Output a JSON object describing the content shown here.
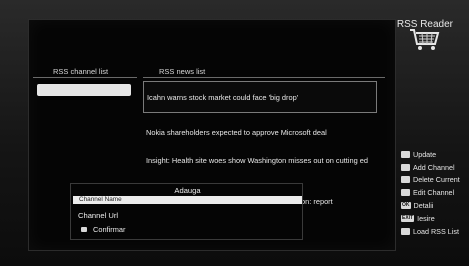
{
  "app": {
    "title": "RSS Reader"
  },
  "columns": {
    "channels_header": "RSS channel list",
    "news_header": "RSS news list"
  },
  "news": [
    "Icahn warns stock market could face 'big drop'",
    "Nokia shareholders expected to approve Microsoft deal",
    "Insight: Health site woes show Washington misses out on cutting ed",
    "t $8 billion: report"
  ],
  "side_menu": [
    {
      "key": "",
      "label": "Update"
    },
    {
      "key": "",
      "label": "Add Channel"
    },
    {
      "key": "",
      "label": "Delete Current"
    },
    {
      "key": "",
      "label": "Edit Channel"
    },
    {
      "key": "OK",
      "label": "Detalii"
    },
    {
      "key": "EXIT",
      "label": "Iesire"
    },
    {
      "key": "",
      "label": "Load RSS List"
    }
  ],
  "dialog": {
    "title": "Adauga",
    "row1": "Channel Name",
    "row2": "Channel Url",
    "confirm": "Confirmar"
  }
}
